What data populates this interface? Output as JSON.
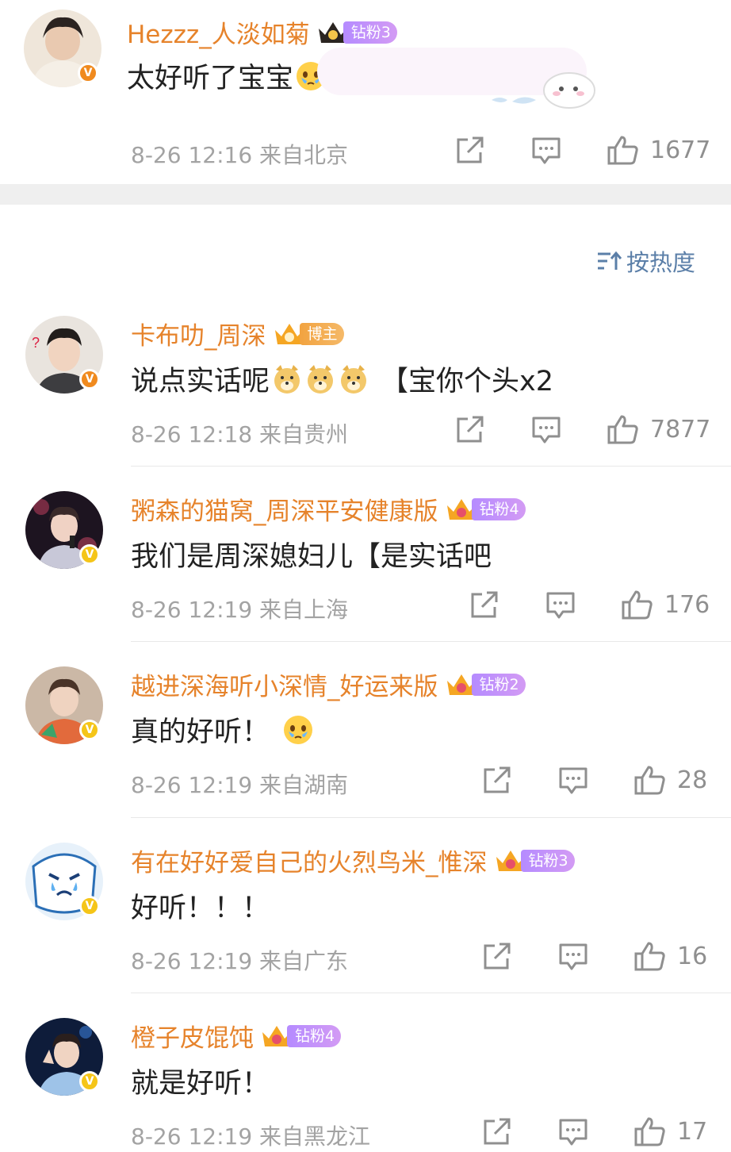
{
  "top_comment": {
    "username": "Hezzz_人淡如菊",
    "badge": "钻粉3",
    "text": "太好听了宝宝",
    "emojis": [
      "teary-face-emoji",
      "teary-face-emoji"
    ],
    "time": "8-26 12:16",
    "location": "来自北京",
    "likes": "1677"
  },
  "sort": {
    "label": "按热度",
    "icon": "sort-icon"
  },
  "comments": [
    {
      "username": "卡布叻_周深",
      "badge": "博主",
      "text": "说点实话呢",
      "emojis": [
        "doge-emoji",
        "doge-emoji",
        "doge-emoji"
      ],
      "text_after": "【宝你个头x2",
      "time": "8-26 12:18",
      "location": "来自贵州",
      "likes": "7877"
    },
    {
      "username": "粥森的猫窝_周深平安健康版",
      "badge": "钻粉4",
      "text": "我们是周深媳妇儿【是实话吧",
      "emojis": [],
      "text_after": "",
      "time": "8-26 12:19",
      "location": "来自上海",
      "likes": "176"
    },
    {
      "username": "越进深海听小深情_好运来版",
      "badge": "钻粉2",
      "text": "真的好听！",
      "emojis": [
        "teary-face-emoji"
      ],
      "text_after": "",
      "time": "8-26 12:19",
      "location": "来自湖南",
      "likes": "28"
    },
    {
      "username": "有在好好爱自己的火烈鸟米_惟深",
      "badge": "钻粉3",
      "text": "好听！！！",
      "emojis": [],
      "text_after": "",
      "time": "8-26 12:19",
      "location": "来自广东",
      "likes": "16"
    },
    {
      "username": "橙子皮馄饨",
      "badge": "钻粉4",
      "text": "就是好听！",
      "emojis": [],
      "text_after": "",
      "time": "8-26 12:19",
      "location": "来自黑龙江",
      "likes": "17"
    }
  ],
  "colors": {
    "username": "#e6832b",
    "badge_purple": "#b58bff",
    "badge_orange": "#f2a340",
    "meta": "#a3a3a3",
    "sort": "#5b7fa8"
  },
  "verified_mark": "V"
}
